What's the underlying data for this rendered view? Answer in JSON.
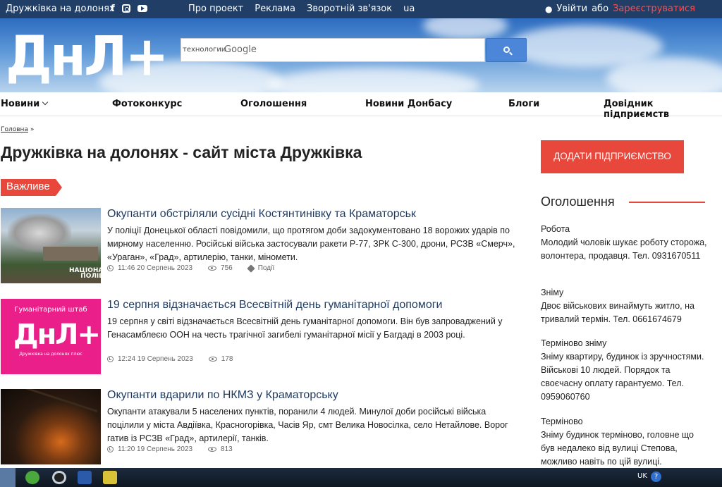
{
  "topbar": {
    "site_name": "Дружківка на долонях",
    "nav": [
      "Про проект",
      "Реклама",
      "Зворотній зв'язок",
      "ua"
    ],
    "login": "Увійти",
    "or": "або",
    "register": "Зареєструватися"
  },
  "banner": {
    "logo": "ДнЛ+",
    "search_brand": "технологии",
    "search_engine": "Google"
  },
  "menu": [
    "Новини",
    "Фотоконкурс",
    "Оголошення",
    "Новини Донбасу",
    "Блоги",
    "Довідник підприємств"
  ],
  "breadcrumb": {
    "home": "Головна",
    "sep": "»"
  },
  "page_title": "Дружківка на долонях - сайт міста Дружківка",
  "badge": "Важливе",
  "articles": [
    {
      "title": "Окупанти обстріляли сусідні Костянтинівку та Краматорськ",
      "desc": "У поліції Донецької області повідомили, що протягом доби задокументовано 18 ворожих ударів по мирному населенню. Російські війська застосували ракети Р-77, ЗРК С-300, дрони, РСЗВ «Смерч», «Ураган», «Град», артилерію, танки, міномети.",
      "time": "11:46 20 Серпень 2023",
      "views": "756",
      "tag": "Події",
      "thumb_text": "НАЦІОНАЛЬНА ПОЛІЦІЯ"
    },
    {
      "title": "19 серпня відзначається Всесвітній день гуманітарної допомоги",
      "desc": "19 серпня у світі відзначається Всесвітній день гуманітарної допомоги. Він був запроваджений у Генасамблеєю ООН на честь трагічної загибелі гуманітарної місії у Багдаді в 2003 році.",
      "time": "12:24 19 Серпень 2023",
      "views": "178",
      "thumb_heading": "Гуманітарний штаб",
      "thumb_logo": "ДнЛ+",
      "thumb_sub": "Дружківка на долонях плюс"
    },
    {
      "title": "Окупанти вдарили по НКМЗ у Краматорську",
      "desc": "Окупанти атакували 5 населених пунктів, поранили 4 людей.  Минулої доби російські війська поцілили у міста Авдіївка, Красногорівка, Часів Яр, смт Велика Новосілка, село Нетайлове. Ворог гатив із РСЗВ «Град», артилерії, танків.",
      "time": "11:20 19 Серпень 2023",
      "views": "813"
    }
  ],
  "sidebar": {
    "add_button": "ДОДАТИ ПІДПРИЄМСТВО",
    "ads_heading": "Оголошення",
    "ads": [
      {
        "cat": "Робота",
        "text": "Молодий чоловік шукає роботу сторожа, волонтера, продавця. Тел. 0931670511"
      },
      {
        "cat": "Зніму",
        "text": "Двоє військових винаймуть житло, на тривалий термін. Тел. 0661674679"
      },
      {
        "cat": "Терміново зніму",
        "text": "Зніму квартиру, будинок із зручностями. Військові 10 людей. Порядок та своєчасну оплату гарантуємо. Тел. 0959060760"
      },
      {
        "cat": "Терміново",
        "text": "Зніму будинок терміново, головне що був недалеко від вулиці Степова, можливо навіть по цій вулиці."
      }
    ]
  },
  "taskbar": {
    "lang": "UK",
    "help": "?"
  },
  "colors": {
    "topbar": "#213f66",
    "accent": "#e8473c",
    "link": "#1f3a5f"
  }
}
